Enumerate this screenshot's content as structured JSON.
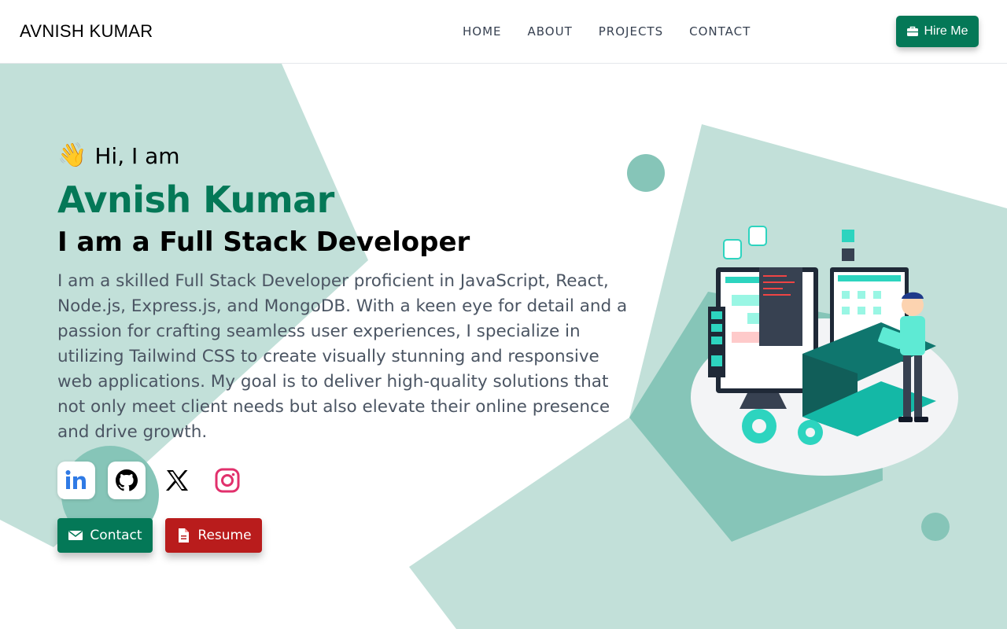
{
  "header": {
    "brand": "AVNISH KUMAR",
    "nav": [
      "HOME",
      "ABOUT",
      "PROJECTS",
      "CONTACT"
    ],
    "hire_label": "Hire Me"
  },
  "hero": {
    "greeting": "Hi, I am",
    "wave_emoji": "👋",
    "name": "Avnish Kumar",
    "role": "I am a Full Stack Developer",
    "description": "I am a skilled Full Stack Developer proficient in JavaScript, React, Node.js, Express.js, and MongoDB. With a keen eye for detail and a passion for crafting seamless user experiences, I specialize in utilizing Tailwind CSS to create visually stunning and responsive web applications. My goal is to deliver high-quality solutions that not only meet client needs but also elevate their online presence and drive growth."
  },
  "socials": [
    "linkedin-icon",
    "github-icon",
    "x-icon",
    "instagram-icon"
  ],
  "actions": {
    "contact_label": "Contact",
    "resume_label": "Resume"
  },
  "colors": {
    "accent": "#047857",
    "danger": "#b91c1c",
    "shape_light": "#c2e0d9",
    "shape_mid": "#86c5b8"
  }
}
